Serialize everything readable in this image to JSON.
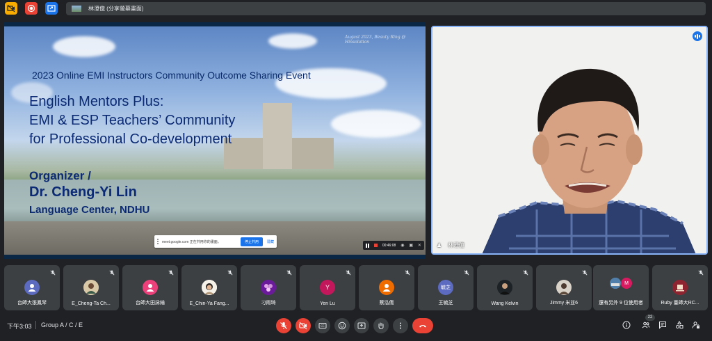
{
  "top_bar": {
    "presenting_text": "林澄億 (分享螢幕畫面)"
  },
  "slide": {
    "watermark": "August 2023, Beauty Ring @ Hinsolation",
    "event_title": "2023 Online EMI Instructors Community Outcome Sharing Event",
    "title_line1": "English Mentors Plus:",
    "title_line2": "EMI & ESP Teachers’ Community",
    "title_line3": "for Professional Co-development",
    "organizer_label": "Organizer /",
    "organizer_name": "Dr. Cheng-Yi Lin",
    "organizer_unit": "Language Center, NDHU"
  },
  "share_notice": {
    "text": "meet.google.com 正在共用你的畫面。",
    "stop_label": "停止共用",
    "hide_label": "隱藏"
  },
  "recorder": {
    "time": "00:46:08"
  },
  "speaker": {
    "name": "林澄億"
  },
  "participants": [
    {
      "name": "台師大張鳳琴",
      "avatar_text": "",
      "color": "#5c6bc0"
    },
    {
      "name": "E_Cheng-Ta Ch...",
      "avatar_text": "",
      "color": "#8d6e63"
    },
    {
      "name": "台師大田詠綸",
      "avatar_text": "",
      "color": "#ec407a"
    },
    {
      "name": "E_Chin-Ya Fang...",
      "avatar_text": "",
      "color": "#bcaaa4"
    },
    {
      "name": "刁雨琦",
      "avatar_text": "",
      "color": "#ab47bc"
    },
    {
      "name": "Yen Lu",
      "avatar_text": "Y",
      "color": "#c2185b"
    },
    {
      "name": "蔡泓儒",
      "avatar_text": "",
      "color": "#ef6c00"
    },
    {
      "name": "王毓芝",
      "avatar_text": "毓芝",
      "color": "#5c6bc0"
    },
    {
      "name": "Wang Kelvin",
      "avatar_text": "",
      "color": "#263238"
    },
    {
      "name": "Jimmy 米並6",
      "avatar_text": "",
      "color": "#6d4c41"
    },
    {
      "name": "還有另外 9 位使用者",
      "avatar_text": "M",
      "color": "#d81b60"
    },
    {
      "name": "Ruby 臺師大RC...",
      "avatar_text": "",
      "color": "#8e2430"
    }
  ],
  "bottom_bar": {
    "time": "下午3:03",
    "meeting": "Group A / C / E",
    "people_count": "22"
  }
}
